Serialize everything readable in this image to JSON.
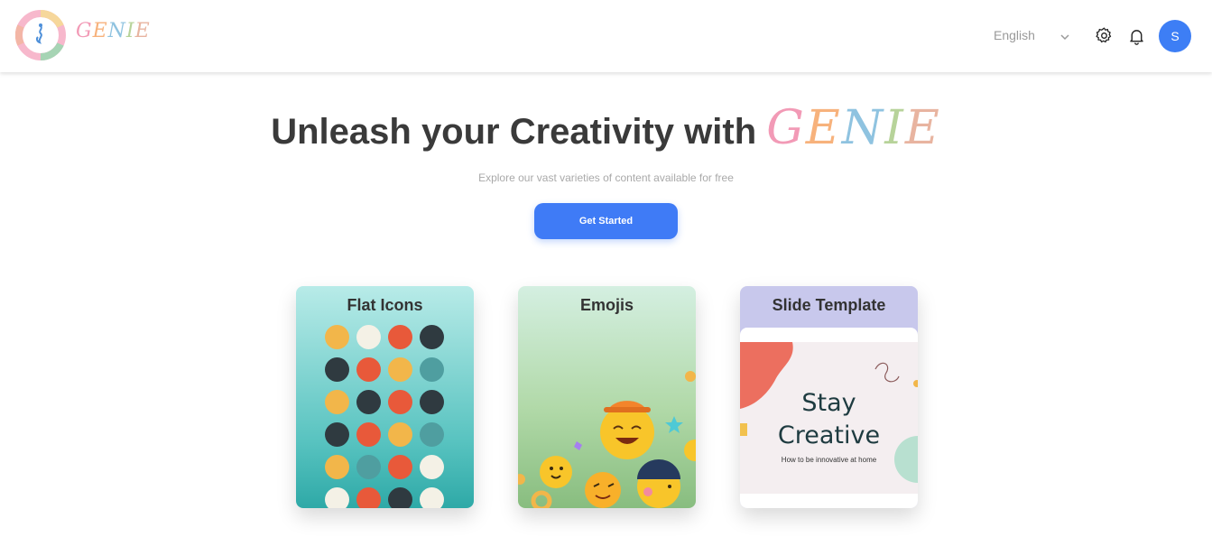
{
  "header": {
    "brand": "GENIE",
    "brand_colors": [
      "#f29ab6",
      "#f7b27c",
      "#8fc3e0",
      "#b7d39a",
      "#e8b4a0"
    ],
    "language": "English",
    "avatar_initial": "S"
  },
  "hero": {
    "title_prefix": "Unleash your Creativity with ",
    "title_brand": "GENIE",
    "subtitle": "Explore our vast varieties of content available for free",
    "cta_label": "Get Started"
  },
  "cards": [
    {
      "title": "Flat Icons"
    },
    {
      "title": "Emojis"
    },
    {
      "title": "Slide Template",
      "slide_title_1": "Stay",
      "slide_title_2": "Creative",
      "slide_subtitle": "How to be innovative at home"
    }
  ],
  "icons": {
    "language_chevron": "chevron-down-icon",
    "settings": "gear-icon",
    "notifications": "bell-icon"
  },
  "colors": {
    "accent": "#3f7bf6",
    "title_text": "#3a3a3a"
  }
}
